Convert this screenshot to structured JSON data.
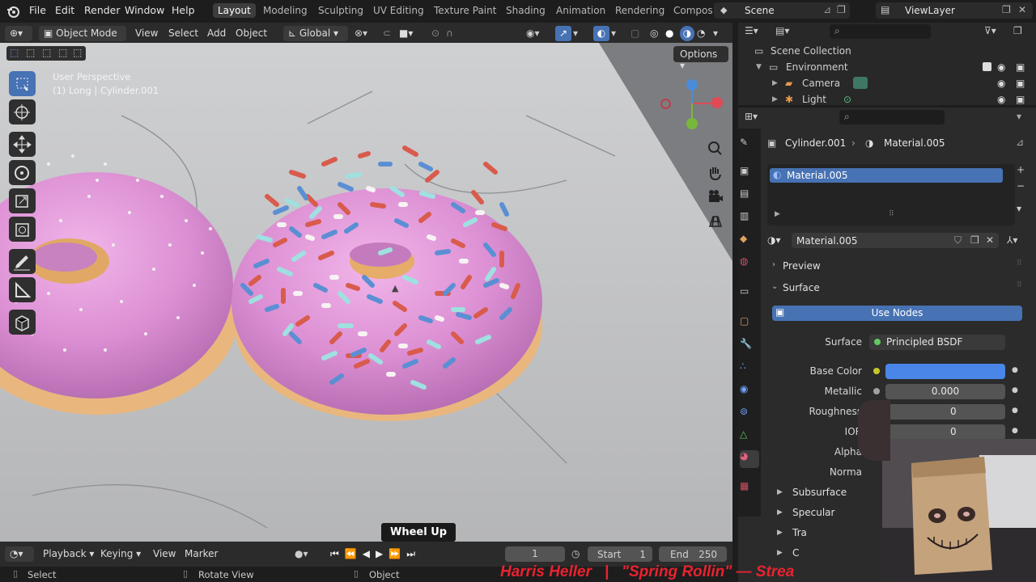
{
  "menu": {
    "file": "File",
    "edit": "Edit",
    "render": "Render",
    "window": "Window",
    "help": "Help"
  },
  "workspaces": [
    "Layout",
    "Modeling",
    "Sculpting",
    "UV Editing",
    "Texture Paint",
    "Shading",
    "Animation",
    "Rendering",
    "Compos"
  ],
  "scene": {
    "name": "Scene",
    "view_layer": "ViewLayer"
  },
  "viewport_header": {
    "mode": "Object Mode",
    "view": "View",
    "select": "Select",
    "add": "Add",
    "object": "Object",
    "orientation": "Global",
    "options": "Options"
  },
  "viewport": {
    "perspective": "User Perspective",
    "object_info": "(1) Long | Cylinder.001",
    "tooltip": "Wheel Up"
  },
  "outliner": {
    "collection": "Scene Collection",
    "items": [
      {
        "label": "Environment"
      },
      {
        "label": "Camera"
      },
      {
        "label": "Light"
      }
    ]
  },
  "properties": {
    "breadcrumb_object": "Cylinder.001",
    "breadcrumb_material": "Material.005",
    "slot": "Material.005",
    "material_name": "Material.005",
    "preview": "Preview",
    "surface_section": "Surface",
    "use_nodes": "Use Nodes",
    "surface_label": "Surface",
    "surface_value": "Principled BSDF",
    "rows": {
      "base_color": "Base Color",
      "metallic": "Metallic",
      "metallic_value": "0.000",
      "roughness": "Roughness",
      "roughness_value": "0",
      "ior": "IOR",
      "ior_value": "0",
      "alpha": "Alpha",
      "normal": "Norma"
    },
    "subsections": [
      "Subsurface",
      "Specular",
      "Tra",
      "C"
    ],
    "base_color": "#4a86e8"
  },
  "timeline": {
    "playback": "Playback",
    "keying": "Keying",
    "view": "View",
    "marker": "Marker",
    "current_frame": "1",
    "start_label": "Start",
    "start": "1",
    "end_label": "End",
    "end": "250"
  },
  "status": {
    "select": "Select",
    "rotate": "Rotate View",
    "object": "Object"
  },
  "ticker": {
    "text": "Harris Heller   |   \"Spring Rollin\" — Strea"
  },
  "colors": {
    "accent": "#4772b3",
    "frosting": "#e096d8",
    "ticker": "#e8232f"
  }
}
